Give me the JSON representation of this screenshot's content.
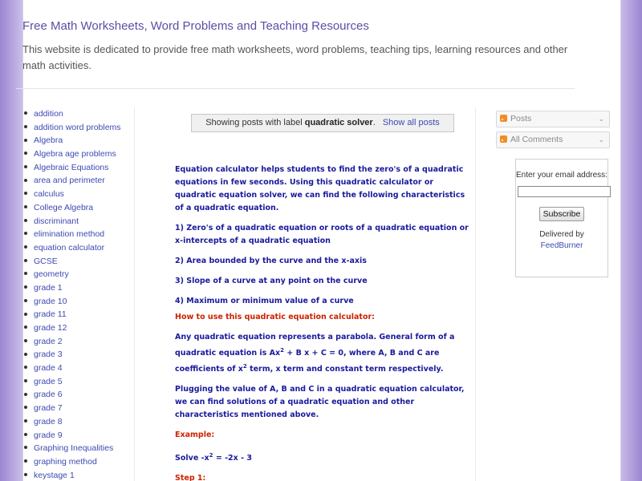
{
  "header": {
    "title": "Free Math Worksheets, Word Problems and Teaching Resources",
    "description": "This website is dedicated to provide free math worksheets, word problems, teaching tips, learning resources and other math activities."
  },
  "sidebar_left": {
    "labels": [
      "addition",
      "addition word problems",
      "Algebra",
      "Algebra age problems",
      "Algebraic Equations",
      "area and perimeter",
      "calculus",
      "College Algebra",
      "discriminant",
      "elimination method",
      "equation calculator",
      "GCSE",
      "geometry",
      "grade 1",
      "grade 10",
      "grade 11",
      "grade 12",
      "grade 2",
      "grade 3",
      "grade 4",
      "grade 5",
      "grade 6",
      "grade 7",
      "grade 8",
      "grade 9",
      "Graphing Inequalities",
      "graphing method",
      "keystage 1"
    ]
  },
  "label_bar": {
    "prefix": "Showing posts with label",
    "label": "quadratic solver",
    "suffix": ".",
    "show_all": "Show all posts"
  },
  "post": {
    "p1": "Equation calculator helps students to find the zero's of a quadratic equations in few seconds. Using this quadratic calculator or quadratic equation solver, we can find the following characteristics of a quadratic equation.",
    "p2": "1) Zero's of a quadratic equation or roots of a quadratic equation or x-intercepts of a quadratic equation",
    "p3": "2) Area bounded by the curve and the x-axis",
    "p4": "3) Slope of a curve at any point on the curve",
    "p5": "4) Maximum or minimum value of a curve",
    "how_to_heading": "How to use this quadratic equation calculator:",
    "p6_a": "Any quadratic equation represents a parabola. General form of a quadratic equation is Ax",
    "p6_sup1": "2",
    "p6_b": " + B x + C = 0, where A, B and C are coefficients of x",
    "p6_sup2": "2",
    "p6_c": " term, x term and constant term respectively.",
    "p7": "Plugging the value of A, B and C in a quadratic equation calculator, we can find solutions of a quadratic equation and other characteristics mentioned above.",
    "example_heading": "Example:",
    "solve_a": "Solve -x",
    "solve_sup": "2",
    "solve_b": " = -2x - 3",
    "step1": "Step 1:"
  },
  "sidebar_right": {
    "posts_label": "Posts",
    "comments_label": "All Comments",
    "email_label": "Enter your email address:",
    "subscribe_label": "Subscribe",
    "delivered_by": "Delivered by",
    "feedburner": "FeedBurner"
  },
  "icons": {
    "feed": "rss-icon",
    "dropdown": "chevron-down-icon"
  },
  "colors": {
    "title": "#5a4fa4",
    "link": "#3d4ab0",
    "post_text": "#1a1a9c",
    "post_heading": "#cc2200",
    "background": "#9a86d0"
  }
}
